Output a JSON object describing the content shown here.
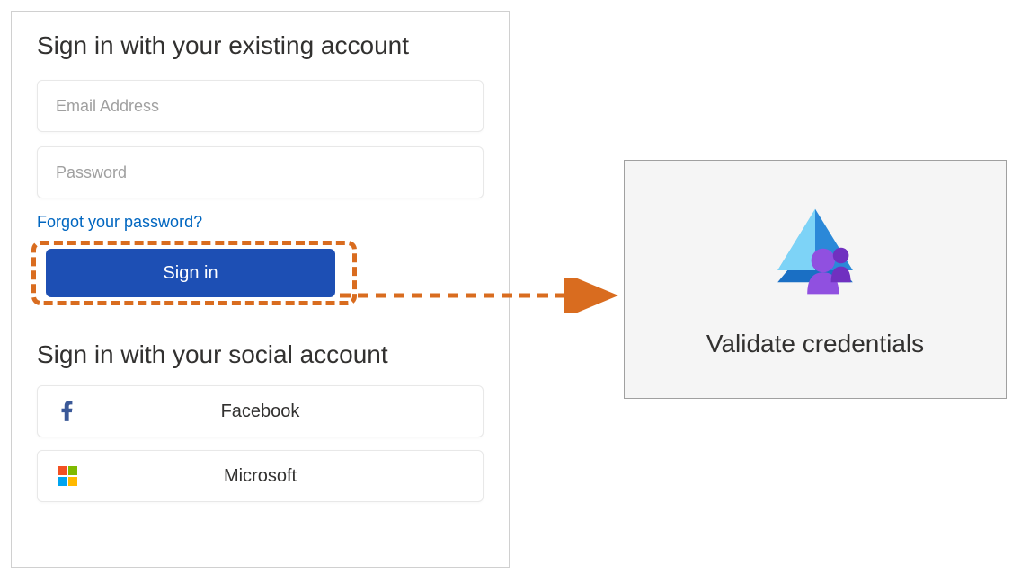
{
  "signin": {
    "existing_title": "Sign in with your existing account",
    "email_placeholder": "Email Address",
    "password_placeholder": "Password",
    "forgot_label": "Forgot your password?",
    "signin_button_label": "Sign in",
    "social_title": "Sign in with your social account",
    "providers": {
      "facebook": "Facebook",
      "microsoft": "Microsoft"
    }
  },
  "validate": {
    "label": "Validate credentials"
  },
  "colors": {
    "highlight": "#d96c1f",
    "primary_button": "#1d4fb4",
    "link": "#0066c0"
  }
}
